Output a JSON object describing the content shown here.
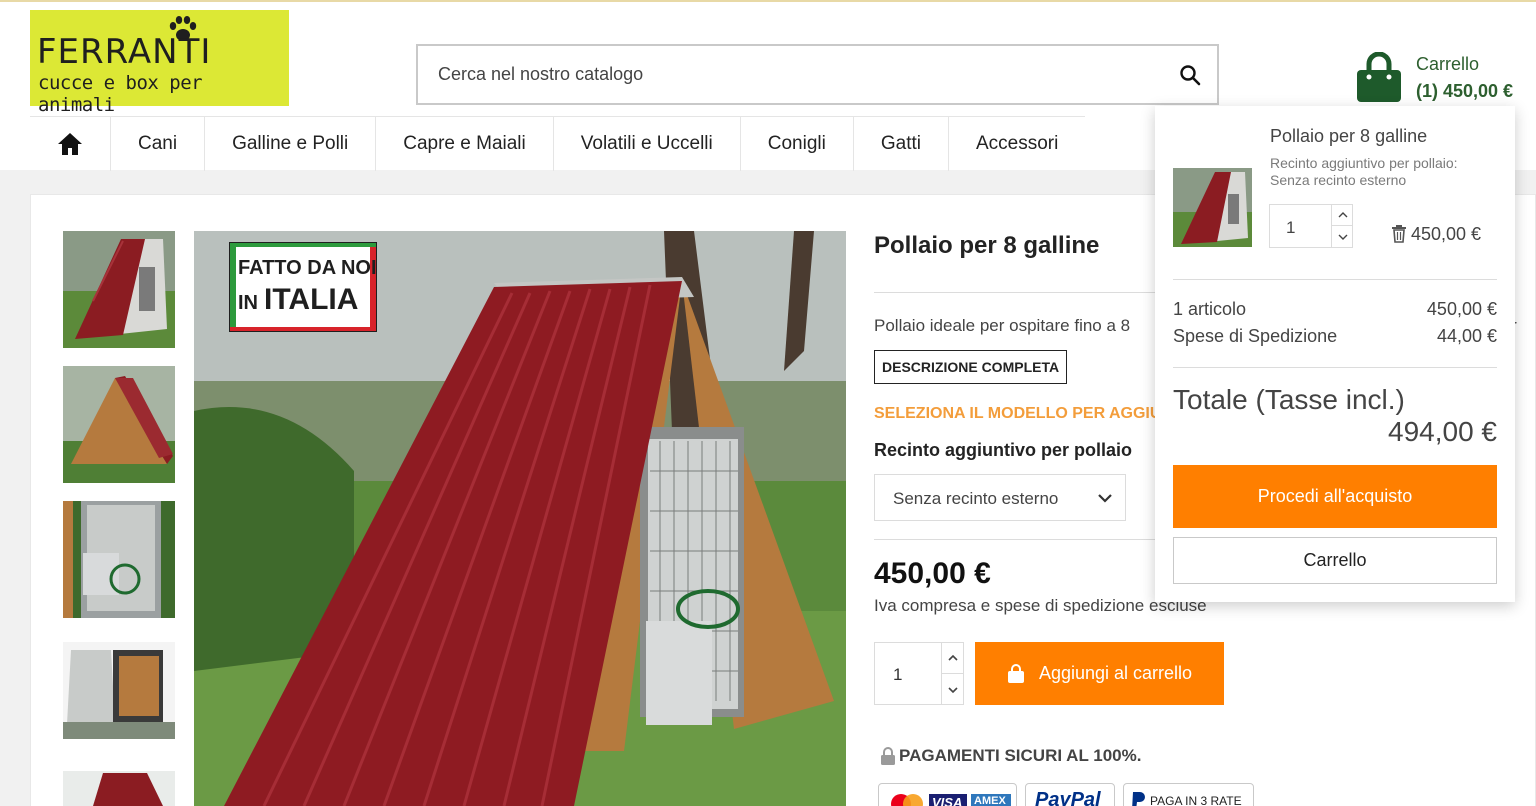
{
  "header": {
    "logo_title": "FERRANTI",
    "logo_tagline": "cucce e box per animali",
    "search_placeholder": "Cerca nel nostro catalogo",
    "cart_label": "Carrello",
    "cart_summary": "(1) 450,00 €"
  },
  "nav": {
    "items": [
      {
        "label": "Cani"
      },
      {
        "label": "Galline e Polli"
      },
      {
        "label": "Capre e Maiali"
      },
      {
        "label": "Volatili e Uccelli"
      },
      {
        "label": "Conigli"
      },
      {
        "label": "Gatti"
      },
      {
        "label": "Accessori"
      }
    ]
  },
  "product": {
    "title": "Pollaio per 8 galline",
    "badge_line1": "FATTO DA NOI",
    "badge_line2_prefix": "IN",
    "badge_line2": "ITALIA",
    "short_description": "Pollaio ideale per ospitare fino a 8",
    "short_description_tail": "n r",
    "description_button": "DESCRIZIONE COMPLETA",
    "select_model_note": "SELEZIONA IL MODELLO PER AGGIU",
    "option_label": "Recinto aggiuntivo per pollaio",
    "option_value": "Senza recinto esterno",
    "price": "450,00 €",
    "tax_note": "Iva compresa e spese di spedizione escluse",
    "quantity": "1",
    "add_to_cart": "Aggiungi al carrello",
    "secure_payments": "PAGAMENTI SICURI AL 100%.",
    "payment_badges": [
      "VISA",
      "AMEX",
      "PayPal",
      "PAGA IN 3 RATE"
    ]
  },
  "cart_dropdown": {
    "product_name": "Pollaio per 8 galline",
    "attribute": "Recinto aggiuntivo per pollaio: Senza recinto esterno",
    "quantity": "1",
    "line_price": "450,00 €",
    "items_label": "1 articolo",
    "items_value": "450,00 €",
    "shipping_label": "Spese di Spedizione",
    "shipping_value": "44,00 €",
    "total_label": "Totale (Tasse incl.)",
    "total_value": "494,00 €",
    "checkout_button": "Procedi all'acquisto",
    "cart_button": "Carrello"
  },
  "colors": {
    "accent": "#ff7f00",
    "cart_green": "#2d5f2f",
    "logo_bg": "#dce835",
    "orange_text": "#f39d3b"
  }
}
